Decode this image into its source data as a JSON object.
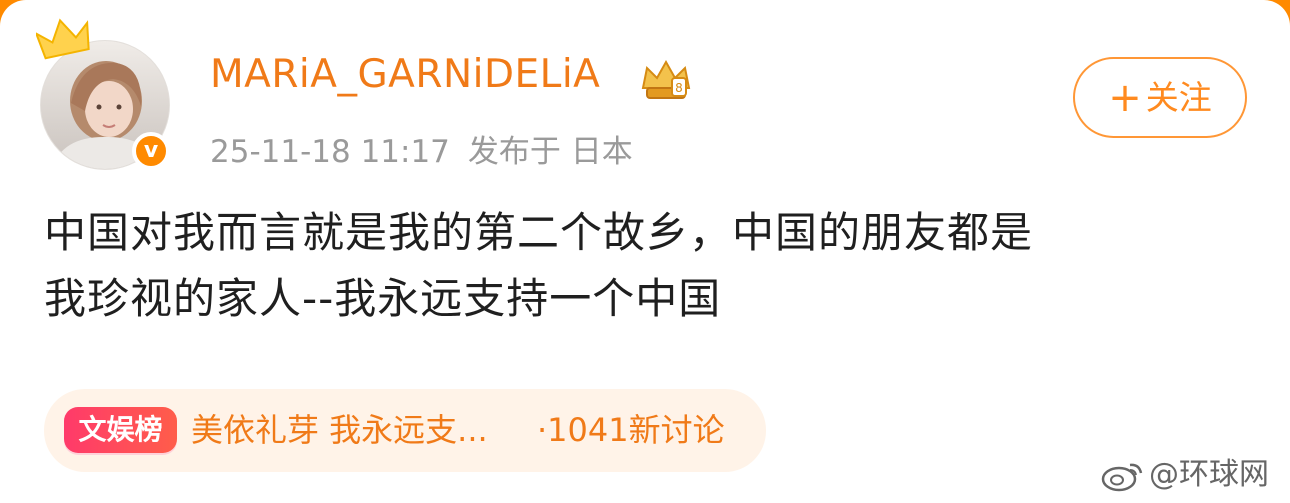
{
  "post": {
    "username": "MARiA_GARNiDELiA",
    "timestamp": "25-11-18 11:17",
    "location": "发布于 日本",
    "follow_button": {
      "plus": "+",
      "label": "关注"
    },
    "content_line1": "中国对我而言就是我的第二个故乡，中国的朋友都是",
    "content_line2": "我珍视的家人--我永远支持一个中国",
    "verified_badge": "v"
  },
  "topic": {
    "tag": "文娱榜",
    "title": "美依礼芽 我永远支...",
    "count": "·1041新讨论"
  },
  "watermark": {
    "text": "@环球网"
  },
  "colors": {
    "accent": "#f07a18",
    "topic_bg": "#fff3e8",
    "tag_red": "#ff3a6a",
    "outer_border": "#ff8a00"
  },
  "icons": {
    "crown": "crown-icon",
    "verified": "verified-badge-icon",
    "member": "member-crown-icon",
    "weibo": "weibo-logo-icon"
  }
}
